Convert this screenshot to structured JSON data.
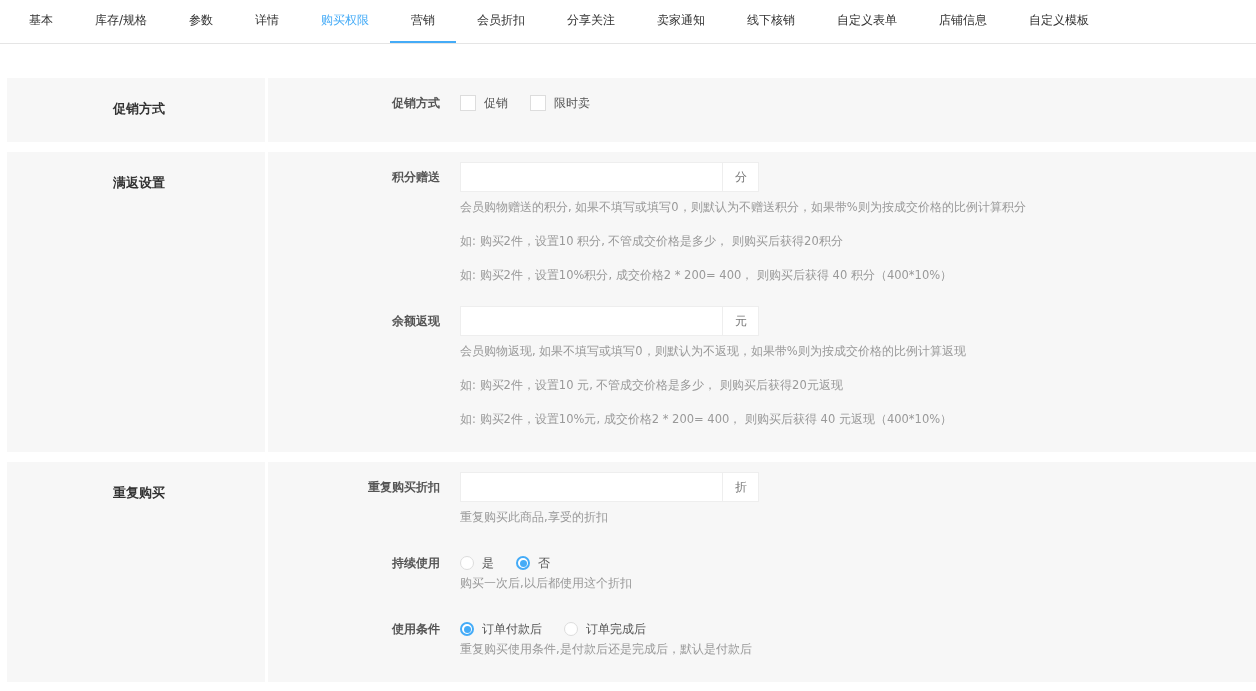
{
  "tabs": [
    {
      "label": "基本",
      "selected": false,
      "hovered": false
    },
    {
      "label": "库存/规格",
      "selected": false,
      "hovered": false
    },
    {
      "label": "参数",
      "selected": false,
      "hovered": false
    },
    {
      "label": "详情",
      "selected": false,
      "hovered": false
    },
    {
      "label": "购买权限",
      "selected": false,
      "hovered": true
    },
    {
      "label": "营销",
      "selected": true,
      "hovered": false
    },
    {
      "label": "会员折扣",
      "selected": false,
      "hovered": false
    },
    {
      "label": "分享关注",
      "selected": false,
      "hovered": false
    },
    {
      "label": "卖家通知",
      "selected": false,
      "hovered": false
    },
    {
      "label": "线下核销",
      "selected": false,
      "hovered": false
    },
    {
      "label": "自定义表单",
      "selected": false,
      "hovered": false
    },
    {
      "label": "店铺信息",
      "selected": false,
      "hovered": false
    },
    {
      "label": "自定义模板",
      "selected": false,
      "hovered": false
    }
  ],
  "sections": [
    {
      "title": "促销方式",
      "fields": [
        {
          "kind": "checkbox",
          "label": "促销方式",
          "options": [
            {
              "label": "促销",
              "checked": false
            },
            {
              "label": "限时卖",
              "checked": false
            }
          ]
        }
      ]
    },
    {
      "title": "满返设置",
      "fields": [
        {
          "kind": "input",
          "label": "积分赠送",
          "unit": "分",
          "hints": [
            "会员购物赠送的积分, 如果不填写或填写0，则默认为不赠送积分，如果带%则为按成交价格的比例计算积分",
            "如: 购买2件，设置10 积分, 不管成交价格是多少， 则购买后获得20积分",
            "如: 购买2件，设置10%积分, 成交价格2 * 200= 400， 则购买后获得 40 积分（400*10%）"
          ]
        },
        {
          "kind": "input",
          "label": "余额返现",
          "unit": "元",
          "hints": [
            "会员购物返现, 如果不填写或填写0，则默认为不返现，如果带%则为按成交价格的比例计算返现",
            "如: 购买2件，设置10 元, 不管成交价格是多少， 则购买后获得20元返现",
            "如: 购买2件，设置10%元, 成交价格2 * 200= 400， 则购买后获得 40 元返现（400*10%）"
          ]
        }
      ]
    },
    {
      "title": "重复购买",
      "fields": [
        {
          "kind": "input",
          "label": "重复购买折扣",
          "unit": "折",
          "hints": [
            "重复购买此商品,享受的折扣"
          ]
        },
        {
          "kind": "radio",
          "label": "持续使用",
          "options": [
            {
              "label": "是",
              "selected": false
            },
            {
              "label": "否",
              "selected": true
            }
          ],
          "hints": [
            "购买一次后,以后都使用这个折扣"
          ]
        },
        {
          "kind": "radio",
          "label": "使用条件",
          "options": [
            {
              "label": "订单付款后",
              "selected": true
            },
            {
              "label": "订单完成后",
              "selected": false
            }
          ],
          "hints": [
            "重复购买使用条件,是付款后还是完成后，默认是付款后"
          ]
        }
      ]
    }
  ]
}
